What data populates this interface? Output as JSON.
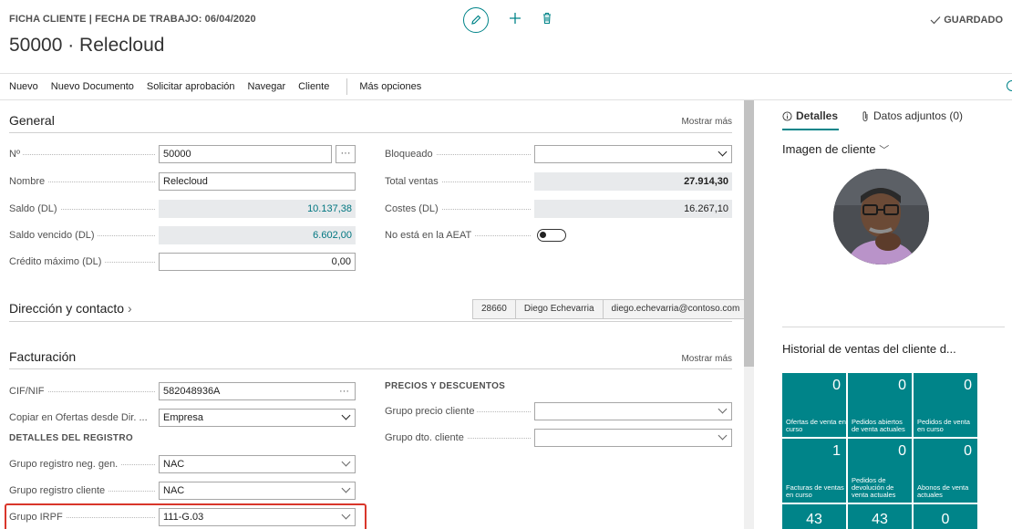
{
  "header": {
    "caption": "FICHA CLIENTE | FECHA DE TRABAJO: 06/04/2020",
    "title": "50000 · Relecloud",
    "saved_label": "GUARDADO"
  },
  "actions": {
    "items": [
      "Nuevo",
      "Nuevo Documento",
      "Solicitar aprobación",
      "Navegar",
      "Cliente"
    ],
    "more": "Más opciones"
  },
  "general": {
    "title": "General",
    "show_more": "Mostrar más",
    "no_label": "Nº",
    "no_value": "50000",
    "nombre_label": "Nombre",
    "nombre_value": "Relecloud",
    "saldo_label": "Saldo (DL)",
    "saldo_value": "10.137,38",
    "saldo_vencido_label": "Saldo vencido (DL)",
    "saldo_vencido_value": "6.602,00",
    "credito_label": "Crédito máximo (DL)",
    "credito_value": "0,00",
    "bloqueado_label": "Bloqueado",
    "bloqueado_value": "",
    "total_ventas_label": "Total ventas",
    "total_ventas_value": "27.914,30",
    "costes_label": "Costes (DL)",
    "costes_value": "16.267,10",
    "aeat_label": "No está en la AEAT"
  },
  "direccion": {
    "title": "Dirección y contacto",
    "postal": "28660",
    "contact": "Diego Echevarria",
    "email": "diego.echevarria@contoso.com"
  },
  "facturacion": {
    "title": "Facturación",
    "show_more": "Mostrar más",
    "cif_label": "CIF/NIF",
    "cif_value": "582048936A",
    "copiar_label": "Copiar en Ofertas desde Dir. ...",
    "copiar_value": "Empresa",
    "registro_heading": "DETALLES DEL REGISTRO",
    "neg_gen_label": "Grupo registro neg. gen.",
    "neg_gen_value": "NAC",
    "cliente_label": "Grupo registro cliente",
    "cliente_value": "NAC",
    "irpf_label": "Grupo IRPF",
    "irpf_value": "111-G.03",
    "precios_heading": "PRECIOS Y DESCUENTOS",
    "precio_label": "Grupo precio cliente",
    "precio_value": "",
    "dto_label": "Grupo dto. cliente",
    "dto_value": ""
  },
  "factbox": {
    "tab_details": "Detalles",
    "tab_attachments": "Datos adjuntos (0)",
    "image_title": "Imagen de cliente",
    "history_title": "Historial de ventas del cliente d...",
    "tiles": [
      {
        "value": "0",
        "caption": "Ofertas de venta en curso"
      },
      {
        "value": "0",
        "caption": "Pedidos abiertos de venta actuales"
      },
      {
        "value": "0",
        "caption": "Pedidos de venta en curso"
      },
      {
        "value": "1",
        "caption": "Facturas de ventas en curso"
      },
      {
        "value": "0",
        "caption": "Pedidos de devolución de venta actuales"
      },
      {
        "value": "0",
        "caption": "Abonos de venta actuales"
      }
    ],
    "bottom_values": [
      "43",
      "43",
      "0"
    ]
  },
  "colors": {
    "accent": "#008489",
    "highlight": "#d9362b",
    "readonly_bg": "#e8eaec"
  }
}
